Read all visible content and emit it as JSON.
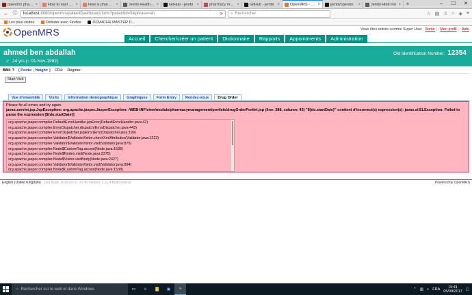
{
  "browser": {
    "tabs": [
      {
        "label": "openmrs pharmac",
        "color": "#8c1a1a"
      },
      {
        "label": "How to start a p",
        "color": "#e27d60"
      },
      {
        "label": "How is pharmac",
        "color": "#e27d60"
      },
      {
        "label": "Jembi Health Sy",
        "color": "#5a5a5a"
      },
      {
        "label": "GitHub - jembi",
        "color": "#111111"
      },
      {
        "label": "pharmacy mana",
        "color": "#c44"
      },
      {
        "label": "GitHub - jembi",
        "color": "#111111"
      },
      {
        "label": "OpenMRS - Pati",
        "color": "#e07a20",
        "active": true
      },
      {
        "label": "jembi/openmr",
        "color": "#111111"
      },
      {
        "label": "Jembi Html For",
        "color": "#5a5a5a"
      }
    ],
    "url_host": "localhost",
    "url_path": ":8080/openmrs/patientDashboard.form?patientId=5&phrase=ah",
    "search_placeholder": "Rechercher",
    "bookmarks": [
      {
        "label": "Les plus visités",
        "color": "#e07a20"
      },
      {
        "label": "Débuter avec Firefox",
        "color": "#e07a20"
      },
      {
        "label": "DCM4CHE MASTER D...",
        "color": "#111111"
      }
    ]
  },
  "app": {
    "logo": "OpenMRS",
    "user_text": "Vous êtes entrés comme Super User",
    "user_links": [
      "Sortie",
      "Mon profil",
      "Aide"
    ],
    "menu": [
      "Accueil",
      "Chercher/créer un patient",
      "Dictionnaire",
      "Rapports",
      "Appointments",
      "Administration"
    ]
  },
  "patient": {
    "name": "ahmed ben abdallah",
    "gender_symbol": "♂",
    "age": "24 yrs (~ 01-Nov-1992)",
    "id_label": "Old Identification Number:",
    "id_value": "12354",
    "bmi_label": "BMI: ?",
    "weight_height": "( Poids: , Height: )",
    "cd4": "CD4:",
    "regime": "Régime:",
    "start_visit": "Start Visit"
  },
  "tabs": [
    "Vue d'ensemble",
    "Visits",
    "Information demographique",
    "Graphiques",
    "Form Entry",
    "Rendez-vous",
    "Drug Order"
  ],
  "active_tab": "Drug Order",
  "error": {
    "message": "Please fix all errors and try again.",
    "exception": "javax.servlet.jsp.JspException: org.apache.jasper.JasperException: /WEB-INF/view/module/pharmacymanagement/portlets/drugOrderPortlet.jsp (line: 288, column: 43) \"${do.startDate}\" contient d'incorrect(s) expression(s): javax.el.ELException: Failed to parse the expression [${do.startDate}]",
    "stack": [
      "org.apache.jasper.compiler.DefaultErrorHandler.jspError(DefaultErrorHandler.java:42)",
      "org.apache.jasper.compiler.ErrorDispatcher.dispatch(ErrorDispatcher.java:443)",
      "org.apache.jasper.compiler.ErrorDispatcher.jspError(ErrorDispatcher.java:199)",
      "org.apache.jasper.compiler.Validator$ValidateVisitor.checkXmlAttributes(Validator.java:1223)",
      "org.apache.jasper.compiler.Validator$ValidateVisitor.visit(Validator.java:875)",
      "org.apache.jasper.compiler.Node$CustomTag.accept(Node.java:1538)",
      "org.apache.jasper.compiler.Node$Nodes.visit(Node.java:2375)",
      "org.apache.jasper.compiler.Node$Visitor.visitBody(Node.java:2427)",
      "org.apache.jasper.compiler.Validator$ValidateVisitor.visit(Validator.java:894)",
      "org.apache.jasper.compiler.Node$CustomTag.accept(Node.java:1538)"
    ]
  },
  "footer": {
    "locale": "English (United Kingdom)",
    "build": "Last Build: 2015-09-21 20:36   Version: 1.11.4 Build 6ebcaf",
    "powered": "Powered by OpenMRS"
  },
  "taskbar": {
    "search_placeholder": "Rechercher sur le web et dans Windows",
    "lang": "FRA",
    "time": "15:41",
    "date": "05/09/2017"
  }
}
